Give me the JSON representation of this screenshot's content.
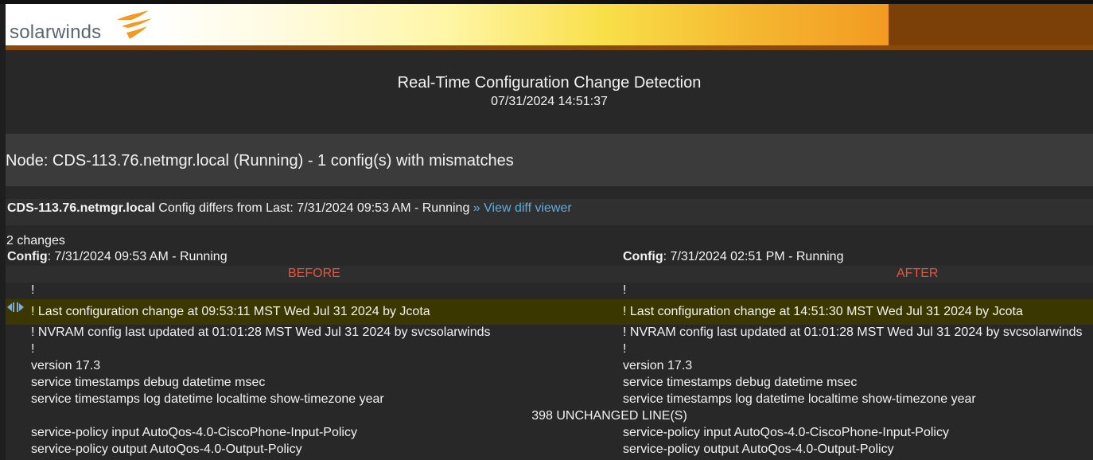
{
  "brand": {
    "logo_text": "solarwinds",
    "logo_icon": "solarwinds-flame-icon"
  },
  "report": {
    "title": "Real-Time Configuration Change Detection",
    "timestamp": "07/31/2024 14:51:37"
  },
  "node": {
    "heading": "Node: CDS-113.76.netmgr.local (Running) - 1 config(s) with mismatches"
  },
  "summary": {
    "node_name": "CDS-113.76.netmgr.local",
    "text": " Config differs from Last: 7/31/2024 09:53 AM - Running ",
    "link": "» View diff viewer"
  },
  "changes": {
    "count_label": "2 changes"
  },
  "configs": {
    "left": {
      "label": "Config",
      "value": ": 7/31/2024 09:53 AM - Running",
      "header": "BEFORE"
    },
    "right": {
      "label": "Config",
      "value": ": 7/31/2024 02:51 PM - Running",
      "header": "AFTER"
    }
  },
  "diff": {
    "rows": [
      {
        "left": "!",
        "right": "!",
        "highlight": false
      },
      {
        "left": "! Last configuration change at 09:53:11 MST Wed Jul 31 2024 by Jcota",
        "right": "! Last configuration change at 14:51:30 MST Wed Jul 31 2024 by Jcota",
        "highlight": true
      },
      {
        "left": "! NVRAM config last updated at 01:01:28 MST Wed Jul 31 2024 by svcsolarwinds",
        "right": "! NVRAM config last updated at 01:01:28 MST Wed Jul 31 2024 by svcsolarwinds",
        "highlight": false
      },
      {
        "left": "!",
        "right": "!",
        "highlight": false
      },
      {
        "left": "version 17.3",
        "right": "version 17.3",
        "highlight": false
      },
      {
        "left": "service timestamps debug datetime msec",
        "right": "service timestamps debug datetime msec",
        "highlight": false
      },
      {
        "left": "service timestamps log datetime localtime show-timezone year",
        "right": "service timestamps log datetime localtime show-timezone year",
        "highlight": false
      },
      {
        "left": "service-policy input AutoQos-4.0-CiscoPhone-Input-Policy",
        "right": "service-policy input AutoQos-4.0-CiscoPhone-Input-Policy",
        "highlight": false
      },
      {
        "left": "service-policy output AutoQos-4.0-Output-Policy",
        "right": "service-policy output AutoQos-4.0-Output-Policy",
        "highlight": false
      }
    ],
    "unchanged_label": "398 UNCHANGED LINE(S)",
    "highlight_color": "#3a3700",
    "header_color": "#e8533a",
    "link_color": "#5aaee0",
    "sync_icon": "diff-sync-arrows-icon"
  }
}
